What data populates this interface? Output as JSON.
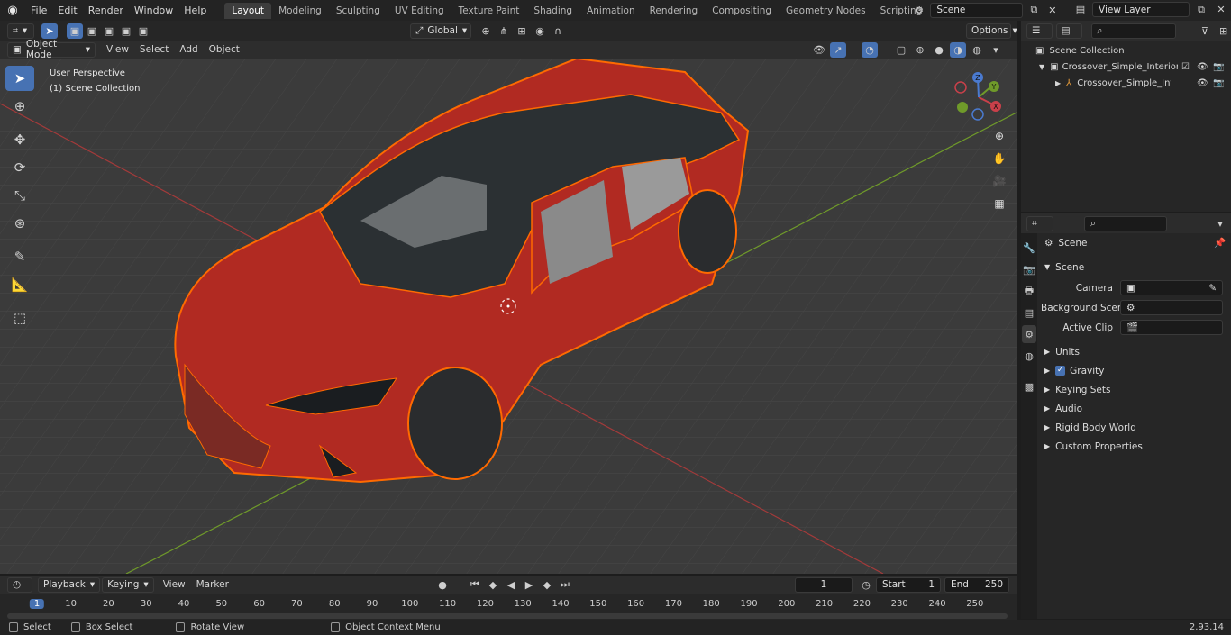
{
  "menubar": {
    "items": [
      "File",
      "Edit",
      "Render",
      "Window",
      "Help"
    ],
    "workspaces": [
      "Layout",
      "Modeling",
      "Sculpting",
      "UV Editing",
      "Texture Paint",
      "Shading",
      "Animation",
      "Rendering",
      "Compositing",
      "Geometry Nodes",
      "Scripting"
    ],
    "active_workspace": "Layout",
    "add_workspace": "+",
    "scene_name": "Scene",
    "view_layer": "View Layer"
  },
  "viewport_header": {
    "orientation": "Global",
    "options_label": "Options"
  },
  "editor_header": {
    "mode": "Object Mode",
    "menus": [
      "View",
      "Select",
      "Add",
      "Object"
    ]
  },
  "viewport": {
    "perspective_label": "User Perspective",
    "collection_label": "(1) Scene Collection",
    "gizmo_axes": {
      "x": "X",
      "y": "Y",
      "z": "Z"
    }
  },
  "outliner": {
    "root": "Scene Collection",
    "items": [
      {
        "label": "Crossover_Simple_Interior_Re"
      },
      {
        "label": "Crossover_Simple_Interic"
      }
    ]
  },
  "properties": {
    "context": "Scene",
    "panel_title": "Scene",
    "fields": [
      {
        "label": "Camera",
        "value": ""
      },
      {
        "label": "Background Scene",
        "value": ""
      },
      {
        "label": "Active Clip",
        "value": ""
      }
    ],
    "subpanels": [
      "Units",
      "Gravity",
      "Keying Sets",
      "Audio",
      "Rigid Body World",
      "Custom Properties"
    ],
    "gravity_checked": true
  },
  "timeline": {
    "menus": [
      "Playback",
      "Keying",
      "View",
      "Marker"
    ],
    "current_frame": "1",
    "start_label": "Start",
    "start_value": "1",
    "end_label": "End",
    "end_value": "250",
    "ruler_ticks": [
      "1",
      "10",
      "20",
      "30",
      "40",
      "50",
      "60",
      "70",
      "80",
      "90",
      "100",
      "110",
      "120",
      "130",
      "140",
      "150",
      "160",
      "170",
      "180",
      "190",
      "200",
      "210",
      "220",
      "230",
      "240",
      "250"
    ]
  },
  "statusbar": {
    "items": [
      "Select",
      "Box Select",
      "Rotate View",
      "Object Context Menu"
    ],
    "version": "2.93.14"
  },
  "colors": {
    "accent": "#4772b3",
    "selection_outline": "#ff6a00",
    "car_body": "#b12a22"
  }
}
